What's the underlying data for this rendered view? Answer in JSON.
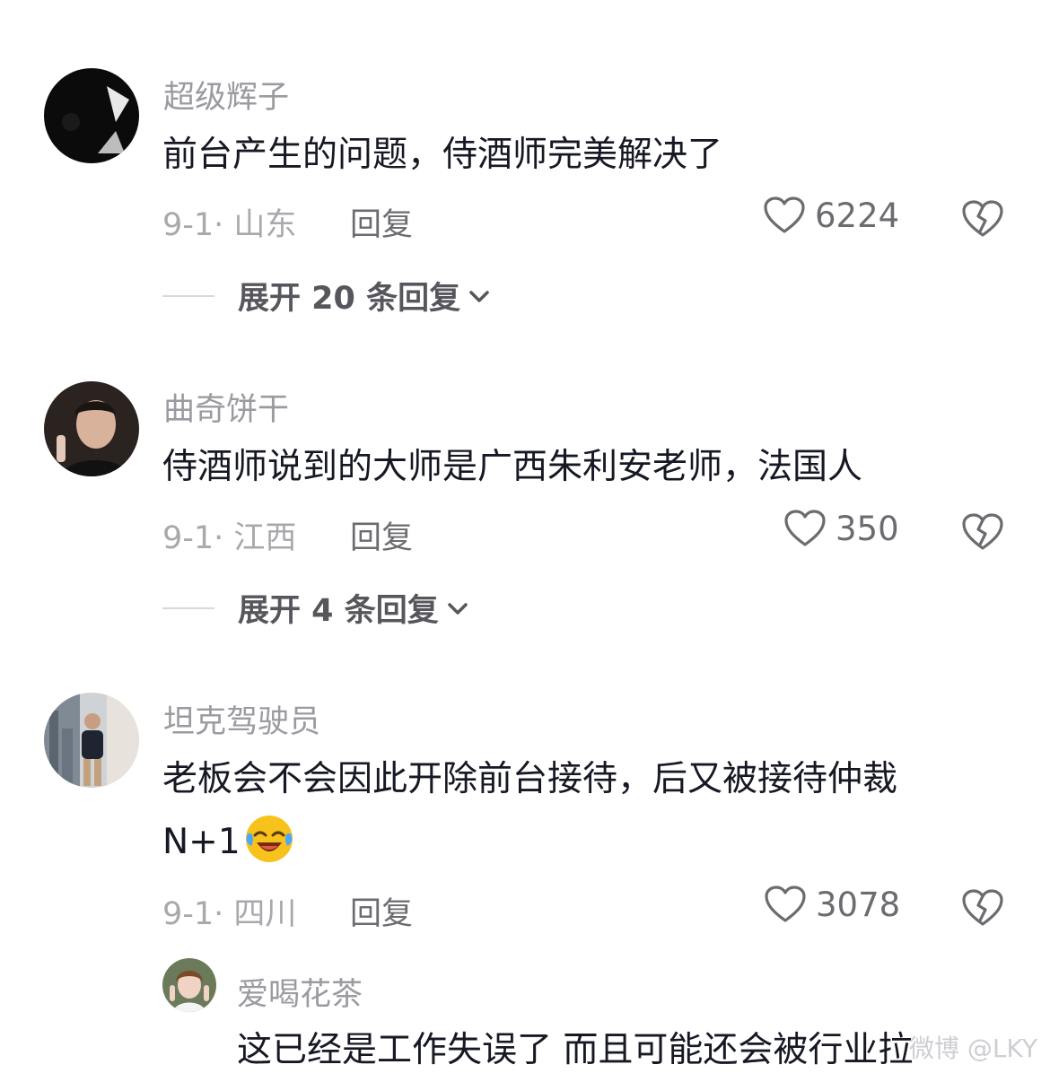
{
  "comments": [
    {
      "username": "超级辉子",
      "text": "前台产生的问题，侍酒师完美解决了",
      "meta": "9-1· 山东",
      "reply_label": "回复",
      "likes": "6224",
      "expand_label": "展开 20 条回复"
    },
    {
      "username": "曲奇饼干",
      "text": "侍酒师说到的大师是广西朱利安老师，法国人",
      "meta": "9-1· 江西",
      "reply_label": "回复",
      "likes": "350",
      "expand_label": "展开 4 条回复"
    },
    {
      "username": "坦克驾驶员",
      "text_line1": "老板会不会因此开除前台接待，后又被接待仲裁",
      "text_line2": "N+1",
      "emoji": "laughing-crying-emoji",
      "meta": "9-1· 四川",
      "reply_label": "回复",
      "likes": "3078"
    }
  ],
  "sub_reply": {
    "username": "爱喝花茶",
    "text": "这已经是工作失误了 而且可能还会被行业拉"
  },
  "watermark": "微博 @LKY",
  "icons": {
    "like": "heart-outline-icon",
    "dislike": "broken-heart-icon",
    "expand": "chevron-down-icon"
  }
}
